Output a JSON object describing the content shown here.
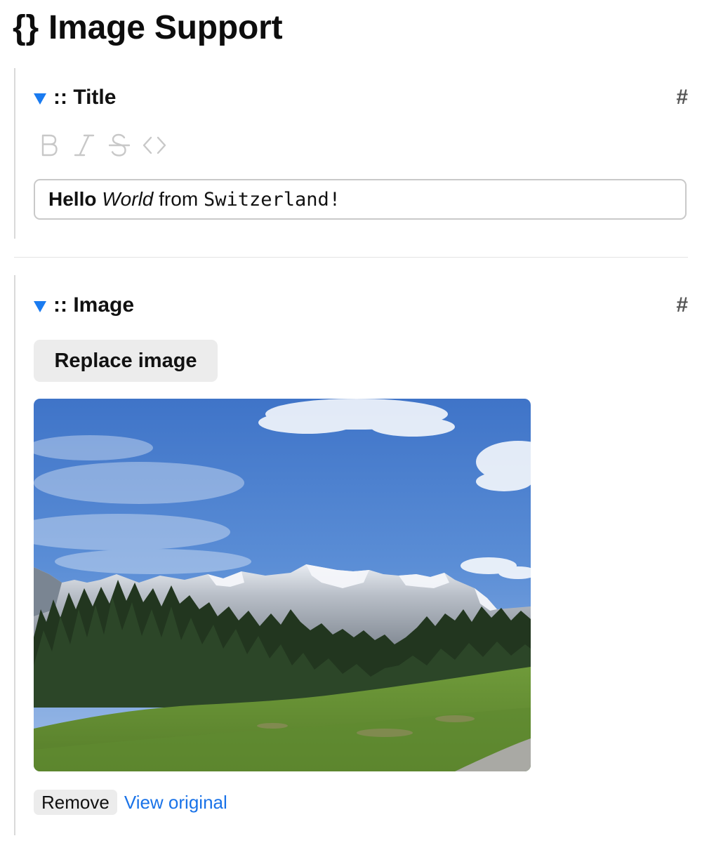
{
  "page": {
    "title_icon": "{}",
    "title": "Image Support"
  },
  "title_field": {
    "label": ":: Title",
    "anchor": "#",
    "toggle_icon": "triangle-down-icon",
    "toolbar": {
      "bold_label": "B",
      "italic_label": "I",
      "strikethrough_label": "S",
      "code_label": "<>"
    },
    "value": {
      "bold": "Hello",
      "italic": "World",
      "plain": "from",
      "code": "Switzerland!"
    }
  },
  "image_field": {
    "label": ":: Image",
    "anchor": "#",
    "toggle_icon": "triangle-down-icon",
    "replace_label": "Replace image",
    "remove_label": "Remove",
    "view_original_label": "View original"
  },
  "colors": {
    "accent": "#1a7bf0",
    "link": "#1a73e8",
    "button_bg": "#ececec",
    "toolbar_icon": "#c8c8c8",
    "anchor": "#555555"
  }
}
